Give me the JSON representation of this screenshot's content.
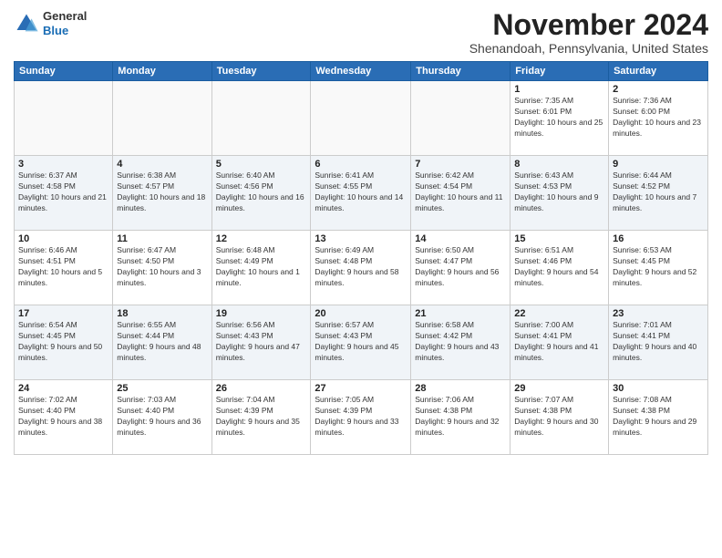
{
  "logo": {
    "general": "General",
    "blue": "Blue"
  },
  "title": "November 2024",
  "subtitle": "Shenandoah, Pennsylvania, United States",
  "days_of_week": [
    "Sunday",
    "Monday",
    "Tuesday",
    "Wednesday",
    "Thursday",
    "Friday",
    "Saturday"
  ],
  "weeks": [
    [
      {
        "day": "",
        "info": ""
      },
      {
        "day": "",
        "info": ""
      },
      {
        "day": "",
        "info": ""
      },
      {
        "day": "",
        "info": ""
      },
      {
        "day": "",
        "info": ""
      },
      {
        "day": "1",
        "info": "Sunrise: 7:35 AM\nSunset: 6:01 PM\nDaylight: 10 hours and 25 minutes."
      },
      {
        "day": "2",
        "info": "Sunrise: 7:36 AM\nSunset: 6:00 PM\nDaylight: 10 hours and 23 minutes."
      }
    ],
    [
      {
        "day": "3",
        "info": "Sunrise: 6:37 AM\nSunset: 4:58 PM\nDaylight: 10 hours and 21 minutes."
      },
      {
        "day": "4",
        "info": "Sunrise: 6:38 AM\nSunset: 4:57 PM\nDaylight: 10 hours and 18 minutes."
      },
      {
        "day": "5",
        "info": "Sunrise: 6:40 AM\nSunset: 4:56 PM\nDaylight: 10 hours and 16 minutes."
      },
      {
        "day": "6",
        "info": "Sunrise: 6:41 AM\nSunset: 4:55 PM\nDaylight: 10 hours and 14 minutes."
      },
      {
        "day": "7",
        "info": "Sunrise: 6:42 AM\nSunset: 4:54 PM\nDaylight: 10 hours and 11 minutes."
      },
      {
        "day": "8",
        "info": "Sunrise: 6:43 AM\nSunset: 4:53 PM\nDaylight: 10 hours and 9 minutes."
      },
      {
        "day": "9",
        "info": "Sunrise: 6:44 AM\nSunset: 4:52 PM\nDaylight: 10 hours and 7 minutes."
      }
    ],
    [
      {
        "day": "10",
        "info": "Sunrise: 6:46 AM\nSunset: 4:51 PM\nDaylight: 10 hours and 5 minutes."
      },
      {
        "day": "11",
        "info": "Sunrise: 6:47 AM\nSunset: 4:50 PM\nDaylight: 10 hours and 3 minutes."
      },
      {
        "day": "12",
        "info": "Sunrise: 6:48 AM\nSunset: 4:49 PM\nDaylight: 10 hours and 1 minute."
      },
      {
        "day": "13",
        "info": "Sunrise: 6:49 AM\nSunset: 4:48 PM\nDaylight: 9 hours and 58 minutes."
      },
      {
        "day": "14",
        "info": "Sunrise: 6:50 AM\nSunset: 4:47 PM\nDaylight: 9 hours and 56 minutes."
      },
      {
        "day": "15",
        "info": "Sunrise: 6:51 AM\nSunset: 4:46 PM\nDaylight: 9 hours and 54 minutes."
      },
      {
        "day": "16",
        "info": "Sunrise: 6:53 AM\nSunset: 4:45 PM\nDaylight: 9 hours and 52 minutes."
      }
    ],
    [
      {
        "day": "17",
        "info": "Sunrise: 6:54 AM\nSunset: 4:45 PM\nDaylight: 9 hours and 50 minutes."
      },
      {
        "day": "18",
        "info": "Sunrise: 6:55 AM\nSunset: 4:44 PM\nDaylight: 9 hours and 48 minutes."
      },
      {
        "day": "19",
        "info": "Sunrise: 6:56 AM\nSunset: 4:43 PM\nDaylight: 9 hours and 47 minutes."
      },
      {
        "day": "20",
        "info": "Sunrise: 6:57 AM\nSunset: 4:43 PM\nDaylight: 9 hours and 45 minutes."
      },
      {
        "day": "21",
        "info": "Sunrise: 6:58 AM\nSunset: 4:42 PM\nDaylight: 9 hours and 43 minutes."
      },
      {
        "day": "22",
        "info": "Sunrise: 7:00 AM\nSunset: 4:41 PM\nDaylight: 9 hours and 41 minutes."
      },
      {
        "day": "23",
        "info": "Sunrise: 7:01 AM\nSunset: 4:41 PM\nDaylight: 9 hours and 40 minutes."
      }
    ],
    [
      {
        "day": "24",
        "info": "Sunrise: 7:02 AM\nSunset: 4:40 PM\nDaylight: 9 hours and 38 minutes."
      },
      {
        "day": "25",
        "info": "Sunrise: 7:03 AM\nSunset: 4:40 PM\nDaylight: 9 hours and 36 minutes."
      },
      {
        "day": "26",
        "info": "Sunrise: 7:04 AM\nSunset: 4:39 PM\nDaylight: 9 hours and 35 minutes."
      },
      {
        "day": "27",
        "info": "Sunrise: 7:05 AM\nSunset: 4:39 PM\nDaylight: 9 hours and 33 minutes."
      },
      {
        "day": "28",
        "info": "Sunrise: 7:06 AM\nSunset: 4:38 PM\nDaylight: 9 hours and 32 minutes."
      },
      {
        "day": "29",
        "info": "Sunrise: 7:07 AM\nSunset: 4:38 PM\nDaylight: 9 hours and 30 minutes."
      },
      {
        "day": "30",
        "info": "Sunrise: 7:08 AM\nSunset: 4:38 PM\nDaylight: 9 hours and 29 minutes."
      }
    ]
  ]
}
